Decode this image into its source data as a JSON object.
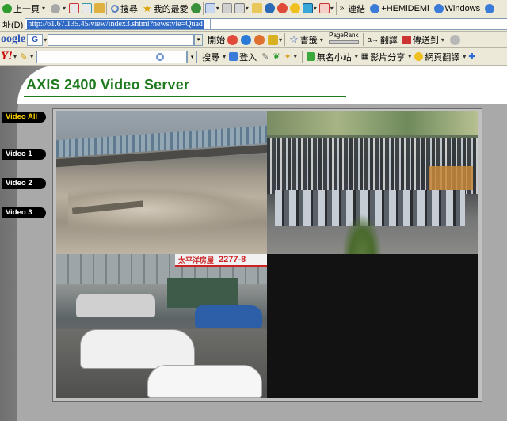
{
  "toolbar": {
    "back_label": "上一頁",
    "search_label": "搜尋",
    "favorites_label": "我的最愛",
    "links_label": "連結",
    "link_items": [
      "+HEMiDEMi",
      "Windows"
    ]
  },
  "address_bar": {
    "label": "址(D)",
    "url": "http://61.67.135.45/view/index3.shtml?newstyle=Quad"
  },
  "google_bar": {
    "logo": "oogle",
    "search_button": "G",
    "go_label": "開始",
    "bookmarks_label": "書籤",
    "pagerank_label": "PageRank",
    "translate_label": "翻譯",
    "send_label": "傳送到"
  },
  "yahoo_bar": {
    "logo": "Y!",
    "search_button": "搜尋",
    "login_label": "登入",
    "homepage_label": "無名小站",
    "video_label": "影片分享",
    "page_translate_label": "網頁翻譯"
  },
  "page": {
    "title": "AXIS 2400 Video Server",
    "nav": [
      {
        "label": "Video All",
        "active": true
      },
      {
        "label": "Video 1",
        "active": false
      },
      {
        "label": "Video 2",
        "active": false
      },
      {
        "label": "Video 3",
        "active": false
      }
    ],
    "feeds": {
      "cam_overlay_sign": "太平洋房屋",
      "cam_overlay_phone": "2277-8"
    }
  },
  "colors": {
    "title_green": "#1d7a1d",
    "nav_active": "#ffd400",
    "address_highlight": "#316ac5"
  }
}
